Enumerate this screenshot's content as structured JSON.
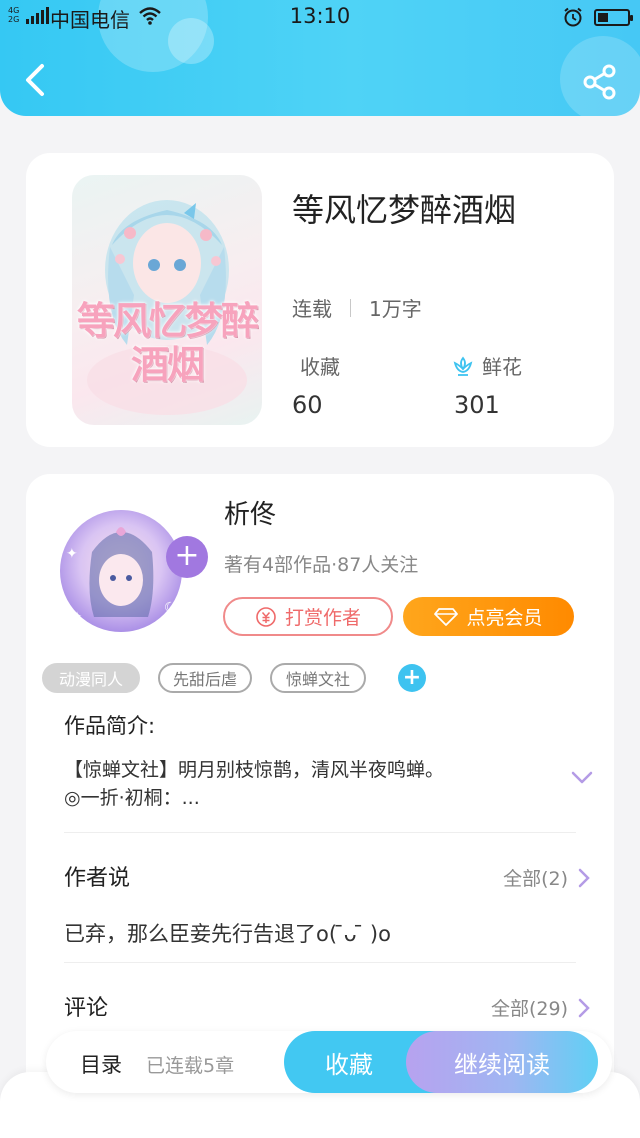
{
  "status_bar": {
    "network": "4G 2G",
    "carrier": "中国电信",
    "time": "13:10"
  },
  "book": {
    "title": "等风忆梦醉酒烟",
    "cover_title": "等风忆梦醉酒烟",
    "status": "连载",
    "word_count": "1万字",
    "favorites_label": "收藏",
    "favorites_value": "60",
    "flowers_label": "鲜花",
    "flowers_value": "301"
  },
  "author": {
    "name": "析佟",
    "info": "著有4部作品·87人关注",
    "reward_label": "打赏作者",
    "vip_label": "点亮会员",
    "tags": [
      "动漫同人",
      "先甜后虐",
      "惊蝉文社"
    ]
  },
  "intro": {
    "label": "作品简介:",
    "line1": "【惊蝉文社】明月别枝惊鹊，清风半夜鸣蝉。",
    "line2": "◎一折·初桐：..."
  },
  "author_says": {
    "label": "作者说",
    "more": "全部(2)",
    "text": "已弃，那么臣妾先行告退了o( ̄ᴗ ̄ )o"
  },
  "comments": {
    "label": "评论",
    "more": "全部(29)"
  },
  "bottom_bar": {
    "toc": "目录",
    "chapters": "已连载5章",
    "favorite": "收藏",
    "continue_reading": "继续阅读"
  },
  "colors": {
    "header": "#3ec8f3",
    "accent_blue": "#42c8f2",
    "vip_orange": "#ff9500",
    "reward_red": "#ef6a6a",
    "avatar_purple": "#a178e0"
  }
}
